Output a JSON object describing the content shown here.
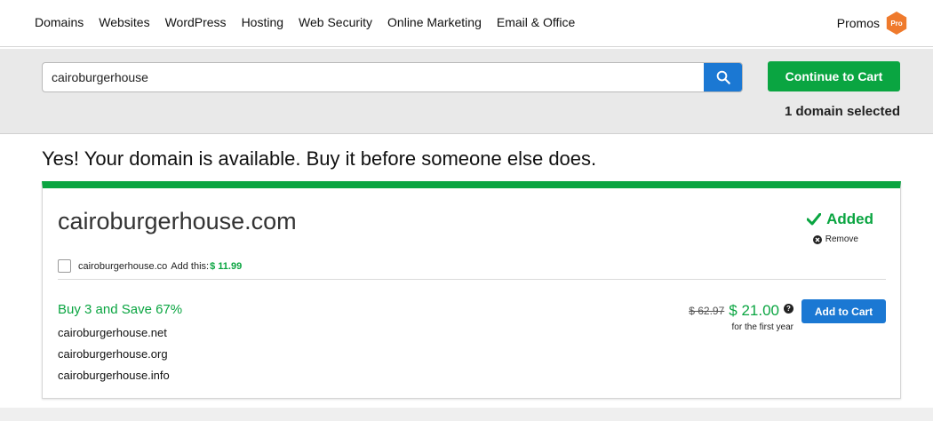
{
  "nav": {
    "items": [
      "Domains",
      "Websites",
      "WordPress",
      "Hosting",
      "Web Security",
      "Online Marketing",
      "Email & Office"
    ],
    "promos_label": "Promos",
    "promos_badge": "Pro"
  },
  "search": {
    "value": "cairoburgerhouse",
    "icon": "search-icon"
  },
  "cart": {
    "continue_label": "Continue to Cart",
    "selected_count": "1 domain selected"
  },
  "headline": "Yes! Your domain is available. Buy it before someone else does.",
  "result": {
    "domain": "cairoburgerhouse.com",
    "status_label": "Added",
    "remove_label": "Remove",
    "addon": {
      "domain": "cairoburgerhouse.co",
      "add_text": "Add this:",
      "price": "$ 11.99"
    },
    "bundle": {
      "title": "Buy 3 and Save 67%",
      "domains": [
        "cairoburgerhouse.net",
        "cairoburgerhouse.org",
        "cairoburgerhouse.info"
      ],
      "old_price": "$ 62.97",
      "new_price": "$ 21.00",
      "price_note": "for the first year",
      "add_label": "Add to Cart"
    }
  },
  "colors": {
    "green": "#0aa541",
    "blue": "#1b78d3",
    "orange": "#ef7a2c"
  }
}
